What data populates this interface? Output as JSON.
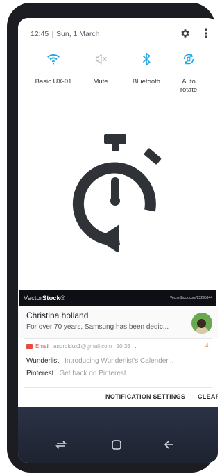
{
  "status": {
    "time": "12:45",
    "date": "Sun, 1 March"
  },
  "quick_settings": [
    {
      "icon": "wifi-icon",
      "label": "Basic UX-01"
    },
    {
      "icon": "mute-icon",
      "label": "Mute"
    },
    {
      "icon": "bluetooth-icon",
      "label": "Bluetooth"
    },
    {
      "icon": "auto-rotate-icon",
      "label": "Auto rotate"
    }
  ],
  "watermark": {
    "brand_prefix": "Vector",
    "brand_bold": "Stock",
    "reg": "®",
    "url": "VectorStock.com/23295944"
  },
  "notification_message": {
    "title": "Christina holland",
    "body": "For over 70 years, Samsung has been dedic..."
  },
  "notification_email": {
    "app": "Email",
    "account": "androidux1@gmail.com",
    "time": "10:35",
    "count": "4",
    "items": [
      {
        "sender": "Wunderlist",
        "subject": "Introducing Wunderlist's Calender..."
      },
      {
        "sender": "Pinterest",
        "subject": "Get back on Pinterest"
      }
    ]
  },
  "actions": {
    "settings_label": "NOTIFICATION SETTINGS",
    "clear_label": "CLEAR"
  },
  "colors": {
    "accent_blue": "#1ea7e8",
    "muted_icon": "#b5b8bc",
    "email_red": "#e74c3c",
    "nav_bg": "#252b3b"
  }
}
